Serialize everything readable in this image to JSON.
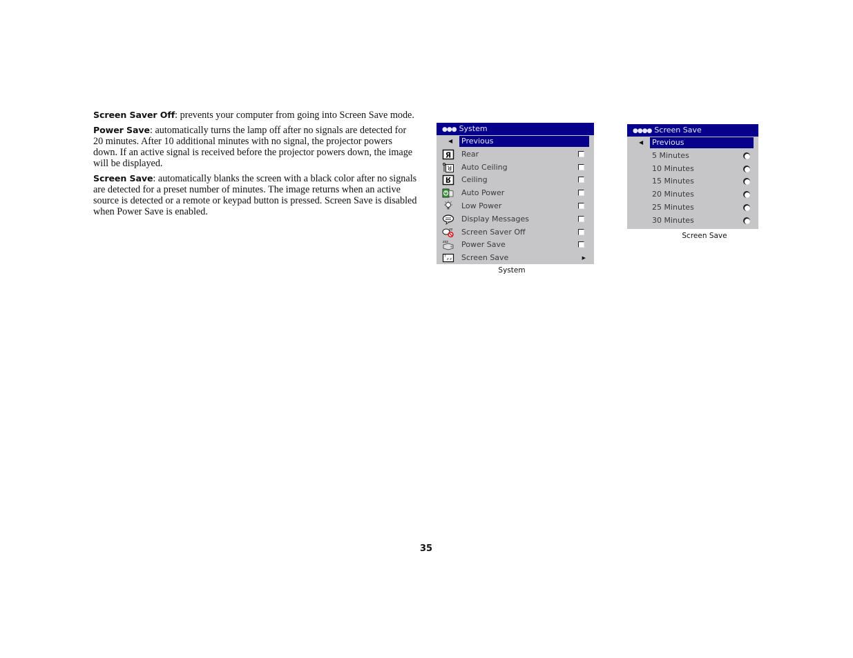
{
  "paragraphs": [
    {
      "term": "Screen Saver Off",
      "text": ": prevents your computer from going into Screen Save mode."
    },
    {
      "term": "Power Save",
      "text": ": automatically turns the lamp off after no signals are detected for 20 minutes. After 10 additional minutes with no signal, the projector powers down. If an active signal is received before the projector powers down, the image will be displayed."
    },
    {
      "term": "Screen Save",
      "text": ": automatically blanks the screen with a black color after no signals are detected for a preset number of minutes. The image returns when an active source is detected or a remote or keypad button is pressed. Screen Save is disabled when Power Save is enabled."
    }
  ],
  "system_menu": {
    "title_dots": "●●●",
    "title": "System",
    "previous_label": "Previous",
    "items": [
      {
        "label": "Rear",
        "icon": "rear-projection-icon",
        "control": "checkbox",
        "checked": false
      },
      {
        "label": "Auto Ceiling",
        "icon": "auto-ceiling-icon",
        "control": "checkbox",
        "checked": false
      },
      {
        "label": "Ceiling",
        "icon": "ceiling-icon",
        "control": "checkbox",
        "checked": false
      },
      {
        "label": "Auto Power",
        "icon": "auto-power-icon",
        "control": "checkbox",
        "checked": false
      },
      {
        "label": "Low Power",
        "icon": "low-power-bulb-icon",
        "control": "checkbox",
        "checked": false
      },
      {
        "label": "Display Messages",
        "icon": "speech-bubble-icon",
        "control": "checkbox",
        "checked": false
      },
      {
        "label": "Screen Saver Off",
        "icon": "screen-saver-off-icon",
        "control": "checkbox",
        "checked": false
      },
      {
        "label": "Power Save",
        "icon": "power-save-icon",
        "control": "checkbox",
        "checked": false
      },
      {
        "label": "Screen Save",
        "icon": "screen-save-icon",
        "control": "submenu"
      }
    ],
    "caption": "System"
  },
  "screensave_menu": {
    "title_dots": "●●●●",
    "title": "Screen Save",
    "previous_label": "Previous",
    "options": [
      "5 Minutes",
      "10 Minutes",
      "15 Minutes",
      "20 Minutes",
      "25 Minutes",
      "30 Minutes"
    ],
    "caption": "Screen Save"
  },
  "page_number": "35",
  "colors": {
    "menu_titlebar": "#06008a",
    "menu_background": "#c6c5c7"
  }
}
